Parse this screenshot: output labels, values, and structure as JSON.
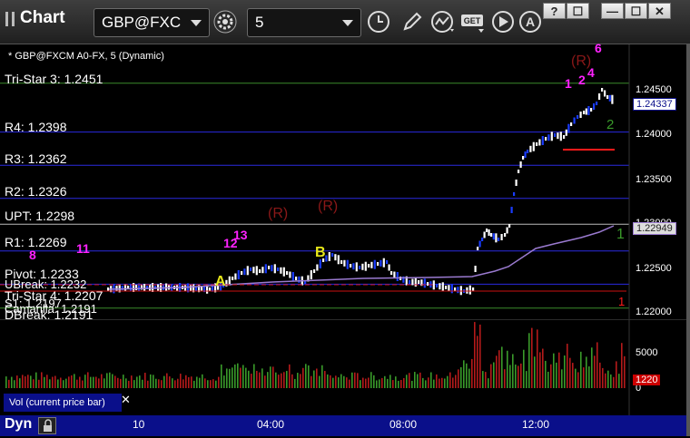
{
  "window": {
    "title": "Chart",
    "symbol": "GBP@FXC",
    "interval": "5",
    "controls": {
      "help": "?",
      "menu": "☐",
      "minimize": "—",
      "maximize": "☐",
      "close": "✕"
    },
    "toolbar_icons": [
      "gear-icon",
      "clock-icon",
      "pencil-icon",
      "line-study-icon",
      "get-icon",
      "play-icon",
      "alert-icon"
    ]
  },
  "price_pane": {
    "subtitle": "* GBP@FXCM A0-FX, 5 (Dynamic)",
    "levels": [
      {
        "label": "Tri-Star 3: 1.2451",
        "price": 1.2451,
        "color": "#3a8a2a"
      },
      {
        "label": "R4: 1.2398",
        "price": 1.2398,
        "color": "#2a2ae0"
      },
      {
        "label": "R3: 1.2362",
        "price": 1.2362,
        "color": "#2a2ae0"
      },
      {
        "label": "R2: 1.2326",
        "price": 1.2326,
        "color": "#2a2ae0"
      },
      {
        "label": "UPT: 1.2298",
        "price": 1.2298,
        "color": "#bbbbbb"
      },
      {
        "label": "R1: 1.2269",
        "price": 1.2269,
        "color": "#2a2ae0"
      },
      {
        "label": "Pivot: 1.2233",
        "price": 1.2233,
        "color": "#2a2ae0"
      },
      {
        "label": "Tri-Star 4: 1.2207",
        "price": 1.2207,
        "color": "#3a8a2a"
      },
      {
        "label": "DBreak: 1.2191",
        "price": 1.2191,
        "color": "#2a2ae0"
      }
    ],
    "overlapped_labels": [
      "UBreak: 1.2232",
      "S1: 1.2197",
      "Camarilla: 1.2191"
    ],
    "price_axis": {
      "ticks": [
        "1.24500",
        "1.24000",
        "1.23500",
        "1.23000",
        "1.22500",
        "1.22000"
      ],
      "min": 1.2195,
      "max": 1.2493
    },
    "last_price": "1.24337",
    "ma_value": "1.22949",
    "marker_labels": {
      "a": "A",
      "b": "B",
      "r": "(R)",
      "n1": "1",
      "n2": "2",
      "n4": "4",
      "n6": "6",
      "n8": "8",
      "n11": "11",
      "n12": "12",
      "n13": "13",
      "g1": "1",
      "g2": "2",
      "r1": "1"
    }
  },
  "volume_pane": {
    "title": "Vol (current price bar)",
    "close": "✕",
    "axis_ticks": [
      "5000",
      "0"
    ],
    "current_volume": "1220"
  },
  "time_axis": {
    "mode": "Dyn",
    "labels": [
      "10",
      "04:00",
      "08:00",
      "12:00"
    ]
  },
  "colors": {
    "background": "#000000",
    "axis_bar": "#0a0f8a",
    "support_resistance": "#2a2ae0",
    "tristar": "#3a8a2a",
    "signal_magenta": "#ff22ff",
    "signal_yellow": "#e8e81a",
    "signal_red": "#8a1818"
  }
}
